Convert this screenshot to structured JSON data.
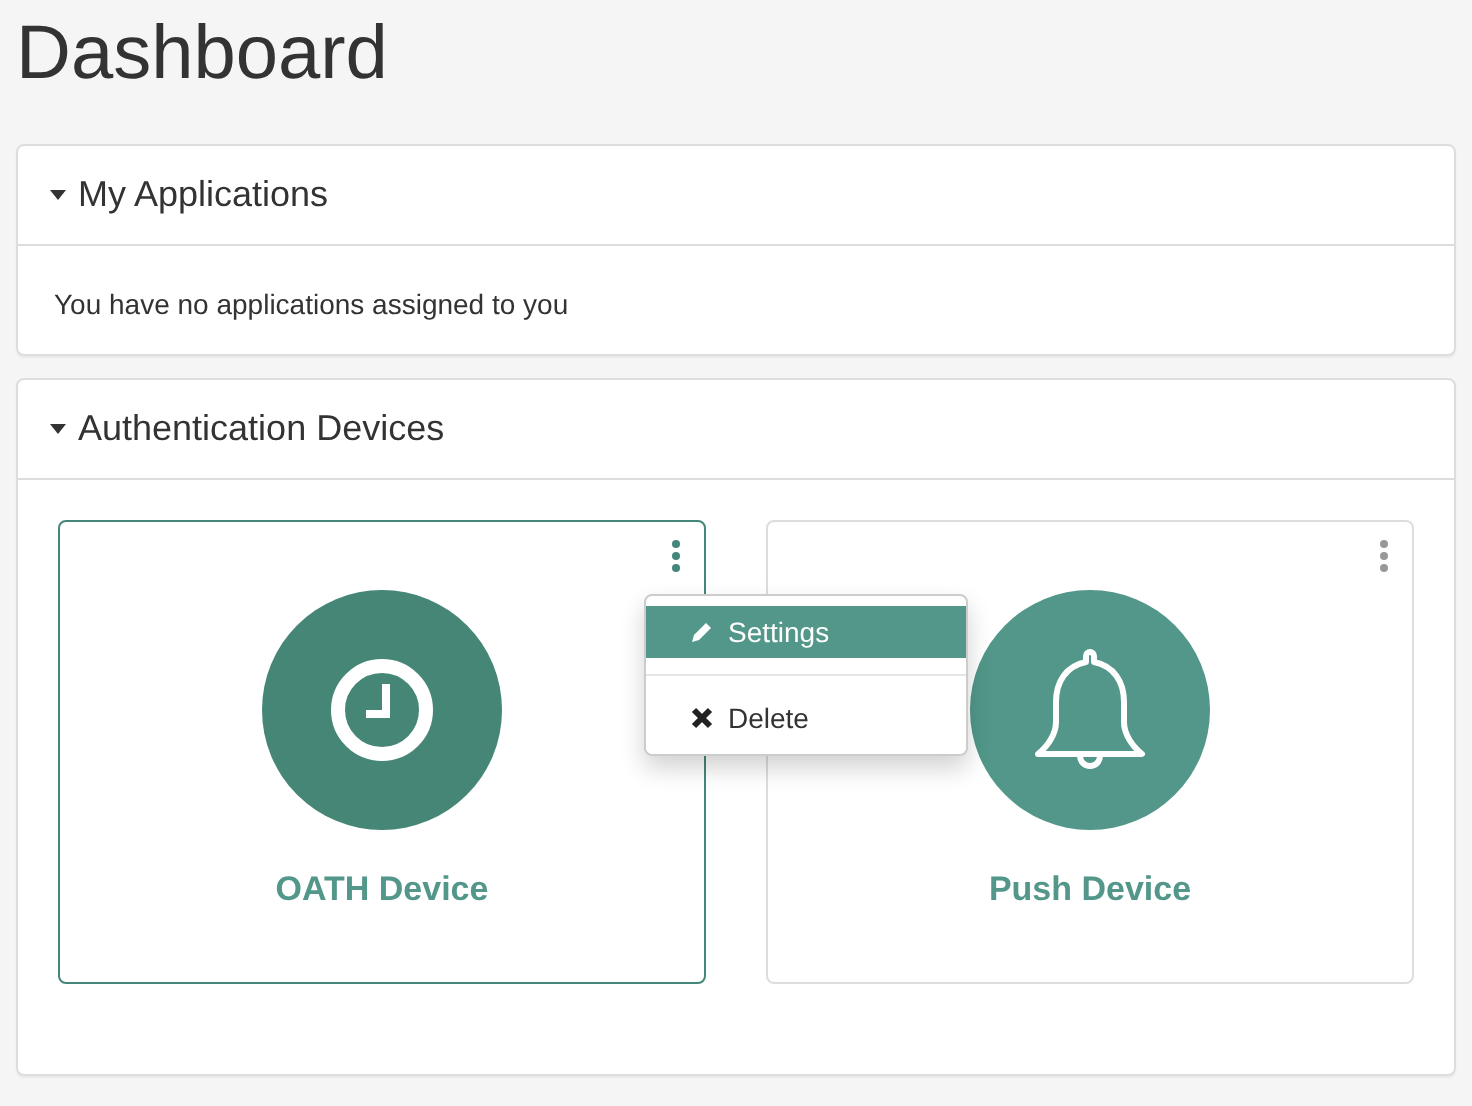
{
  "title": "Dashboard",
  "panels": [
    {
      "title": "My Applications",
      "expanded": true,
      "message": "You have no applications assigned to you"
    },
    {
      "title": "Authentication Devices",
      "expanded": true,
      "devices": [
        {
          "name": "OATH Device",
          "kind": "clock",
          "selected": true,
          "menu": [
            {
              "label": "Settings",
              "kind": "edit",
              "selected": true
            },
            {
              "label": "Delete",
              "kind": "delete",
              "selected": false
            }
          ]
        },
        {
          "name": "Push Device",
          "kind": "bell",
          "selected": false
        }
      ]
    }
  ]
}
